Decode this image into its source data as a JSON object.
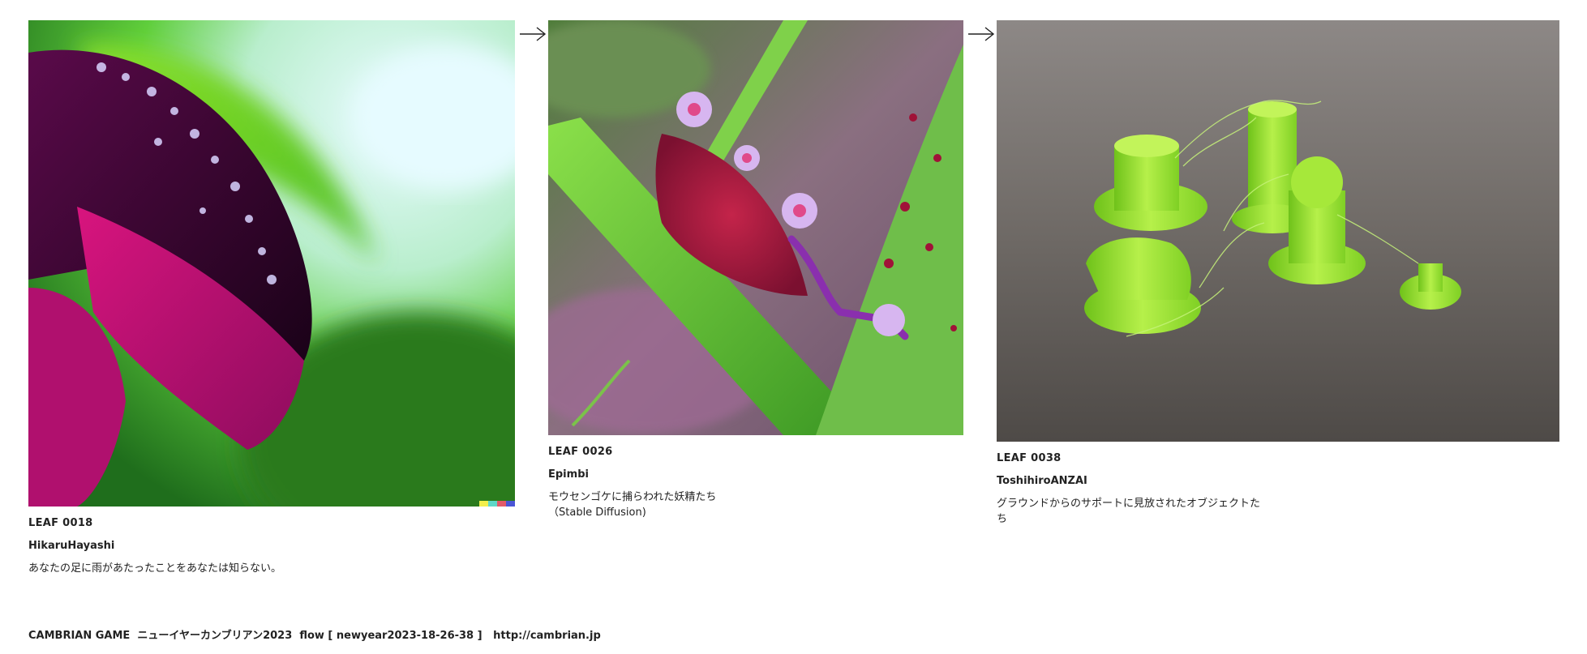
{
  "leaves": [
    {
      "code": "LEAF 0018",
      "author": "HikaruHayashi",
      "caption": "あなたの足に雨があたったことをあなたは知らない。"
    },
    {
      "code": "LEAF 0026",
      "author": "Epimbi",
      "caption": "モウセンゴケに捕らわれた妖精たち\n（Stable Diffusion)"
    },
    {
      "code": "LEAF 0038",
      "author": "ToshihiroANZAI",
      "caption": "グラウンドからのサポートに見放されたオブジェクトたち"
    }
  ],
  "footer": {
    "site_name": "CAMBRIAN GAME",
    "event_title": "ニューイヤーカンブリアン2023",
    "flow_label": "flow [ newyear2023-18-26-38 ]",
    "url": "http://cambrian.jp"
  },
  "colors": {
    "text": "#222222",
    "background": "#ffffff",
    "photo1_petal": "#c8127a",
    "photo1_leaf": "#7ed321",
    "photo2_creature": "#b8224a",
    "photo2_leaf": "#5aa52a",
    "photo3_print": "#9be52b",
    "photo3_table": "#6e6862"
  },
  "icons": [
    "right-arrow-icon",
    "right-arrow-icon"
  ]
}
